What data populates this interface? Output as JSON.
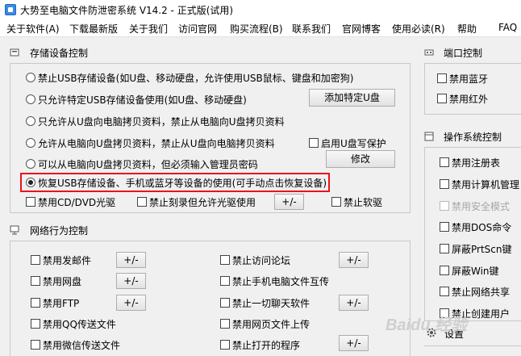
{
  "window": {
    "title": "大势至电脑文件防泄密系统 V14.2 - 正式版(试用)"
  },
  "menu": [
    "关于软件(A)",
    "下载最新版",
    "关于我们",
    "访问官网",
    "购买流程(B)",
    "联系我们",
    "官网博客",
    "使用必读(R)",
    "帮助",
    "FAQ"
  ],
  "storage": {
    "title": "存储设备控制",
    "options": [
      "禁止USB存储设备(如U盘、移动硬盘，允许使用USB鼠标、键盘和加密狗)",
      "只允许特定USB存储设备使用(如U盘、移动硬盘)",
      "只允许从U盘向电脑拷贝资料，禁止从电脑向U盘拷贝资料",
      "允许从电脑向U盘拷贝资料，禁止从U盘向电脑拷贝资料",
      "可以从电脑向U盘拷贝资料，但必须输入管理员密码",
      "恢复USB存储设备、手机或蓝牙等设备的使用(可手动点击恢复设备)"
    ],
    "selected_index": 5,
    "add_specific_u_button": "添加特定U盘",
    "enable_u_write_protect": "启用U盘写保护",
    "modify_button": "修改",
    "disable_cd_dvd": "禁用CD/DVD光驱",
    "disable_burn_allow_cd": "禁止刻录但允许光驱使用",
    "plus_minus": "+/-",
    "disable_floppy": "禁止软驱"
  },
  "network": {
    "title": "网络行为控制",
    "left": [
      {
        "label": "禁用发邮件",
        "has_button": true
      },
      {
        "label": "禁用网盘",
        "has_button": true
      },
      {
        "label": "禁用FTP",
        "has_button": true
      },
      {
        "label": "禁用QQ传送文件",
        "has_button": false
      },
      {
        "label": "禁用微信传送文件",
        "has_button": false
      }
    ],
    "right": [
      {
        "label": "禁止访问论坛",
        "has_button": true
      },
      {
        "label": "禁止手机电脑文件互传",
        "has_button": false
      },
      {
        "label": "禁止一切聊天软件",
        "has_button": true
      },
      {
        "label": "禁用网页文件上传",
        "has_button": false
      },
      {
        "label": "禁止打开的程序",
        "has_button": true
      }
    ],
    "button_label": "+/-"
  },
  "port": {
    "title": "端口控制",
    "items": [
      "禁用蓝牙",
      "禁用红外"
    ]
  },
  "os": {
    "title": "操作系统控制",
    "items": [
      "禁用注册表",
      "禁用计算机管理",
      "禁用安全模式",
      "禁用DOS命令",
      "屏蔽PrtScn键",
      "屏蔽Win键",
      "禁止网络共享",
      "禁止创建用户"
    ],
    "disabled_index": 2
  },
  "settings": {
    "label": "设置"
  },
  "watermark": "Baidu 经验"
}
